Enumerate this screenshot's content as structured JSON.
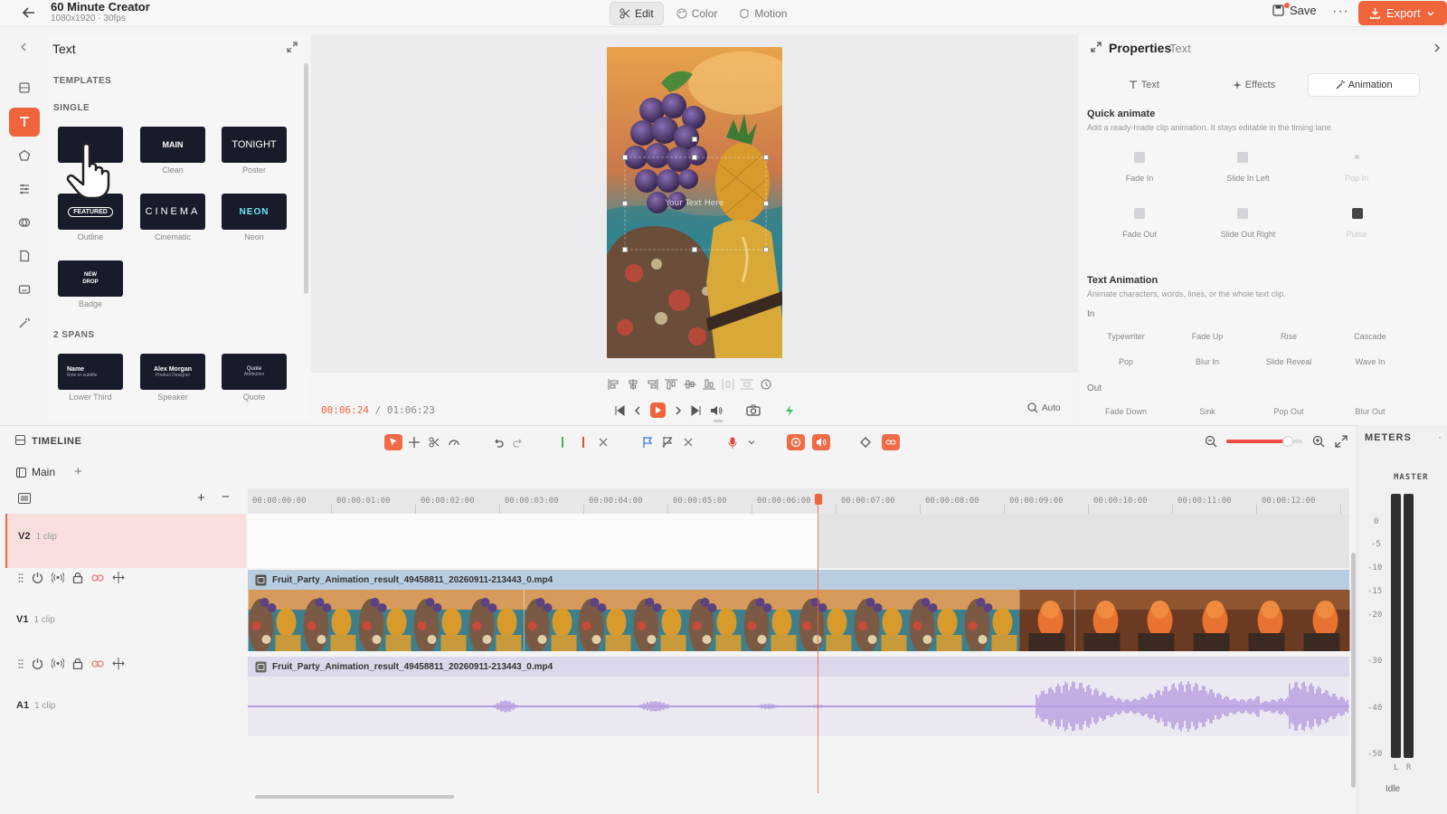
{
  "project": {
    "title": "60 Minute Creator",
    "subtitle": "1080x1920 · 30fps"
  },
  "modes": [
    {
      "label": "Edit",
      "icon": "scissors-icon",
      "active": true
    },
    {
      "label": "Color",
      "icon": "palette-icon",
      "active": false
    },
    {
      "label": "Motion",
      "icon": "motion-icon",
      "active": false
    }
  ],
  "actions": {
    "save": "Save",
    "more": "···",
    "export": "Export"
  },
  "text_panel": {
    "title": "Text",
    "templates_label": "TEMPLATES",
    "single_label": "SINGLE",
    "spans_label": "2 SPANS",
    "single": [
      {
        "preview": "",
        "caption": ""
      },
      {
        "preview": "MAIN",
        "caption": "Clean"
      },
      {
        "preview": "TONIGHT",
        "caption": "Poster"
      },
      {
        "preview": "FEATURED",
        "caption": "Outline"
      },
      {
        "preview": "CINEMA",
        "caption": "Cinematic"
      },
      {
        "preview": "NEON",
        "caption": "Neon"
      },
      {
        "preview": "NEW DROP",
        "caption": "Badge"
      }
    ],
    "spans": [
      {
        "preview": "Name",
        "preview2": "Role or subtitle",
        "caption": "Lower Third"
      },
      {
        "preview": "Alex Morgan",
        "preview2": "Product Designer",
        "caption": "Speaker"
      },
      {
        "preview": "Quote",
        "preview2": "Attribution",
        "caption": "Quote"
      }
    ]
  },
  "preview": {
    "overlay_text": "Your Text Here",
    "current_time": "00:06:24",
    "separator": "/",
    "total_time": "01:06:23",
    "zoom": "Auto"
  },
  "properties": {
    "title": "Properties",
    "subtitle": "Text",
    "tabs": [
      {
        "label": "Text",
        "active": false
      },
      {
        "label": "Effects",
        "active": false
      },
      {
        "label": "Animation",
        "active": true
      }
    ],
    "quick_animate": {
      "title": "Quick animate",
      "desc": "Add a ready-made clip animation. It stays editable in the timing lane.",
      "items": [
        "Fade In",
        "Slide In Left",
        "Pop In",
        "Fade Out",
        "Slide Out Right",
        "Pulse"
      ]
    },
    "text_animation": {
      "title": "Text Animation",
      "desc": "Animate characters, words, lines, or the whole text clip.",
      "in_label": "In",
      "in_items": [
        "Typewriter",
        "Fade Up",
        "Rise",
        "Cascade",
        "Pop",
        "Blur In",
        "Slide Reveal",
        "Wave In"
      ],
      "out_label": "Out",
      "out_items": [
        "Fade Down",
        "Sink",
        "Pop Out",
        "Blur Out"
      ]
    }
  },
  "timeline": {
    "title": "TIMELINE",
    "sequence": "Main",
    "ruler": [
      "00:00:00:00",
      "00:00:01:00",
      "00:00:02:00",
      "00:00:03:00",
      "00:00:04:00",
      "00:00:05:00",
      "00:00:06:00",
      "00:00:07:00",
      "00:00:08:00",
      "00:00:09:00",
      "00:00:10:00",
      "00:00:11:00",
      "00:00:12:00"
    ],
    "tracks": [
      {
        "name": "V2",
        "count": "1 clip"
      },
      {
        "name": "V1",
        "count": "1 clip",
        "clip": "Fruit_Party_Animation_result_49458811_20260911-213443_0.mp4"
      },
      {
        "name": "A1",
        "count": "1 clip",
        "clip": "Fruit_Party_Animation_result_49458811_20260911-213443_0.mp4"
      }
    ]
  },
  "meters": {
    "title": "METERS",
    "master": "MASTER",
    "scale": [
      "0",
      "-5",
      "-10",
      "-15",
      "-20",
      "-30",
      "-40",
      "-50"
    ],
    "channels": [
      "L",
      "R"
    ],
    "status": "Idle"
  },
  "colors": {
    "accent": "#f0643c",
    "video_clip": "#b9cde0",
    "audio_clip": "#d9d3ea",
    "waveform": "#b79ee0"
  }
}
